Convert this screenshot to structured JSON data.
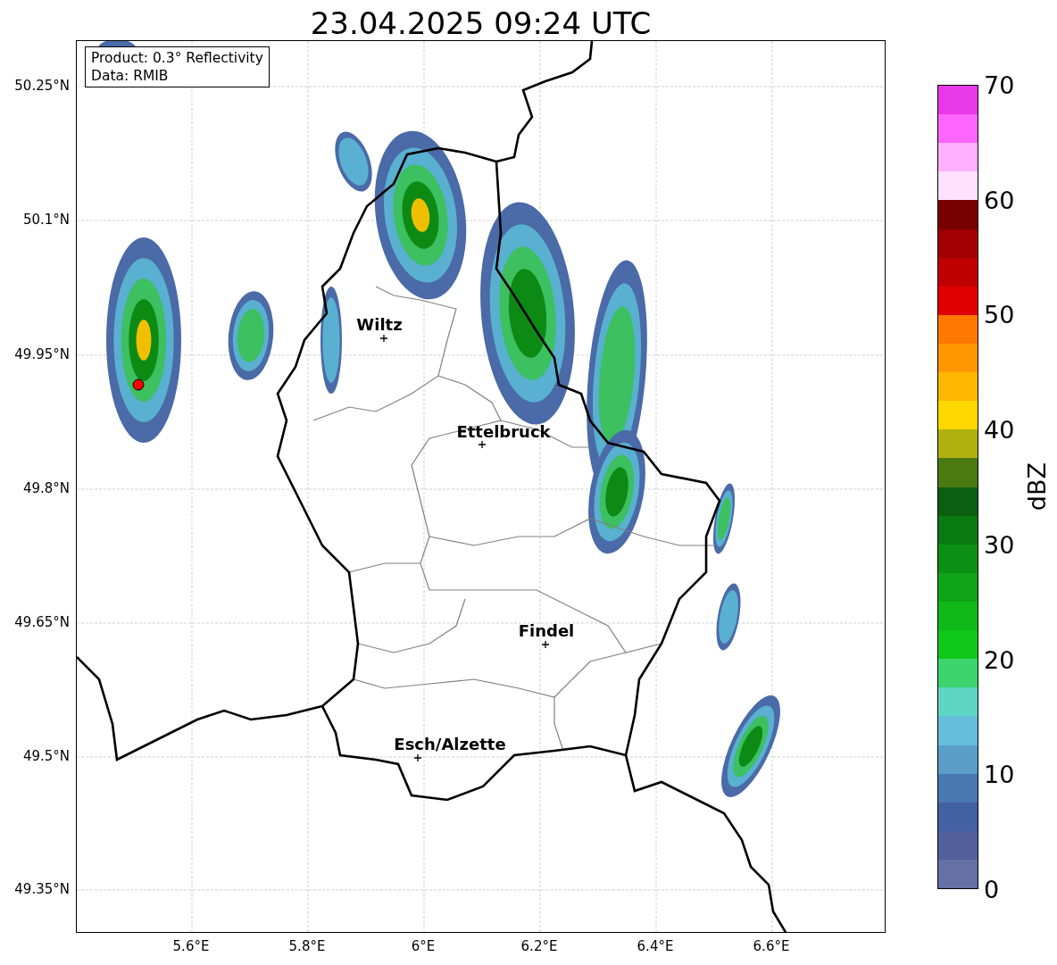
{
  "title": "23.04.2025 09:24 UTC",
  "legend": [
    "Product: 0.3° Reflectivity",
    "Data: RMIB"
  ],
  "cities": [
    {
      "name": "Wiltz"
    },
    {
      "name": "Ettelbruck"
    },
    {
      "name": "Findel"
    },
    {
      "name": "Esch/Alzette"
    }
  ],
  "yticks": [
    "50.25°N",
    "50.1°N",
    "49.95°N",
    "49.8°N",
    "49.65°N",
    "49.5°N",
    "49.35°N"
  ],
  "xticks": [
    "5.6°E",
    "5.8°E",
    "6°E",
    "6.2°E",
    "6.4°E",
    "6.6°E"
  ],
  "colorbar": {
    "label": "dBZ",
    "ticks": [
      "70",
      "60",
      "50",
      "40",
      "30",
      "20",
      "10",
      "0"
    ],
    "bins": [
      {
        "color": "#e838e8"
      },
      {
        "color": "#ff66ff"
      },
      {
        "color": "#ffb0ff"
      },
      {
        "color": "#ffe0ff"
      },
      {
        "color": "#780000"
      },
      {
        "color": "#a00000"
      },
      {
        "color": "#c00000"
      },
      {
        "color": "#e00000"
      },
      {
        "color": "#ff7800"
      },
      {
        "color": "#ff9800"
      },
      {
        "color": "#ffb800"
      },
      {
        "color": "#ffd800"
      },
      {
        "color": "#b0b010"
      },
      {
        "color": "#4a7a10"
      },
      {
        "color": "#0a6010"
      },
      {
        "color": "#0a7a12"
      },
      {
        "color": "#0c9014"
      },
      {
        "color": "#10a418"
      },
      {
        "color": "#10b818"
      },
      {
        "color": "#10c818"
      },
      {
        "color": "#3cd46c"
      },
      {
        "color": "#5ed6c4"
      },
      {
        "color": "#64bedc"
      },
      {
        "color": "#5a9ec8"
      },
      {
        "color": "#4a78b0"
      },
      {
        "color": "#4360a0"
      },
      {
        "color": "#52619c"
      },
      {
        "color": "#6470a6"
      }
    ]
  }
}
